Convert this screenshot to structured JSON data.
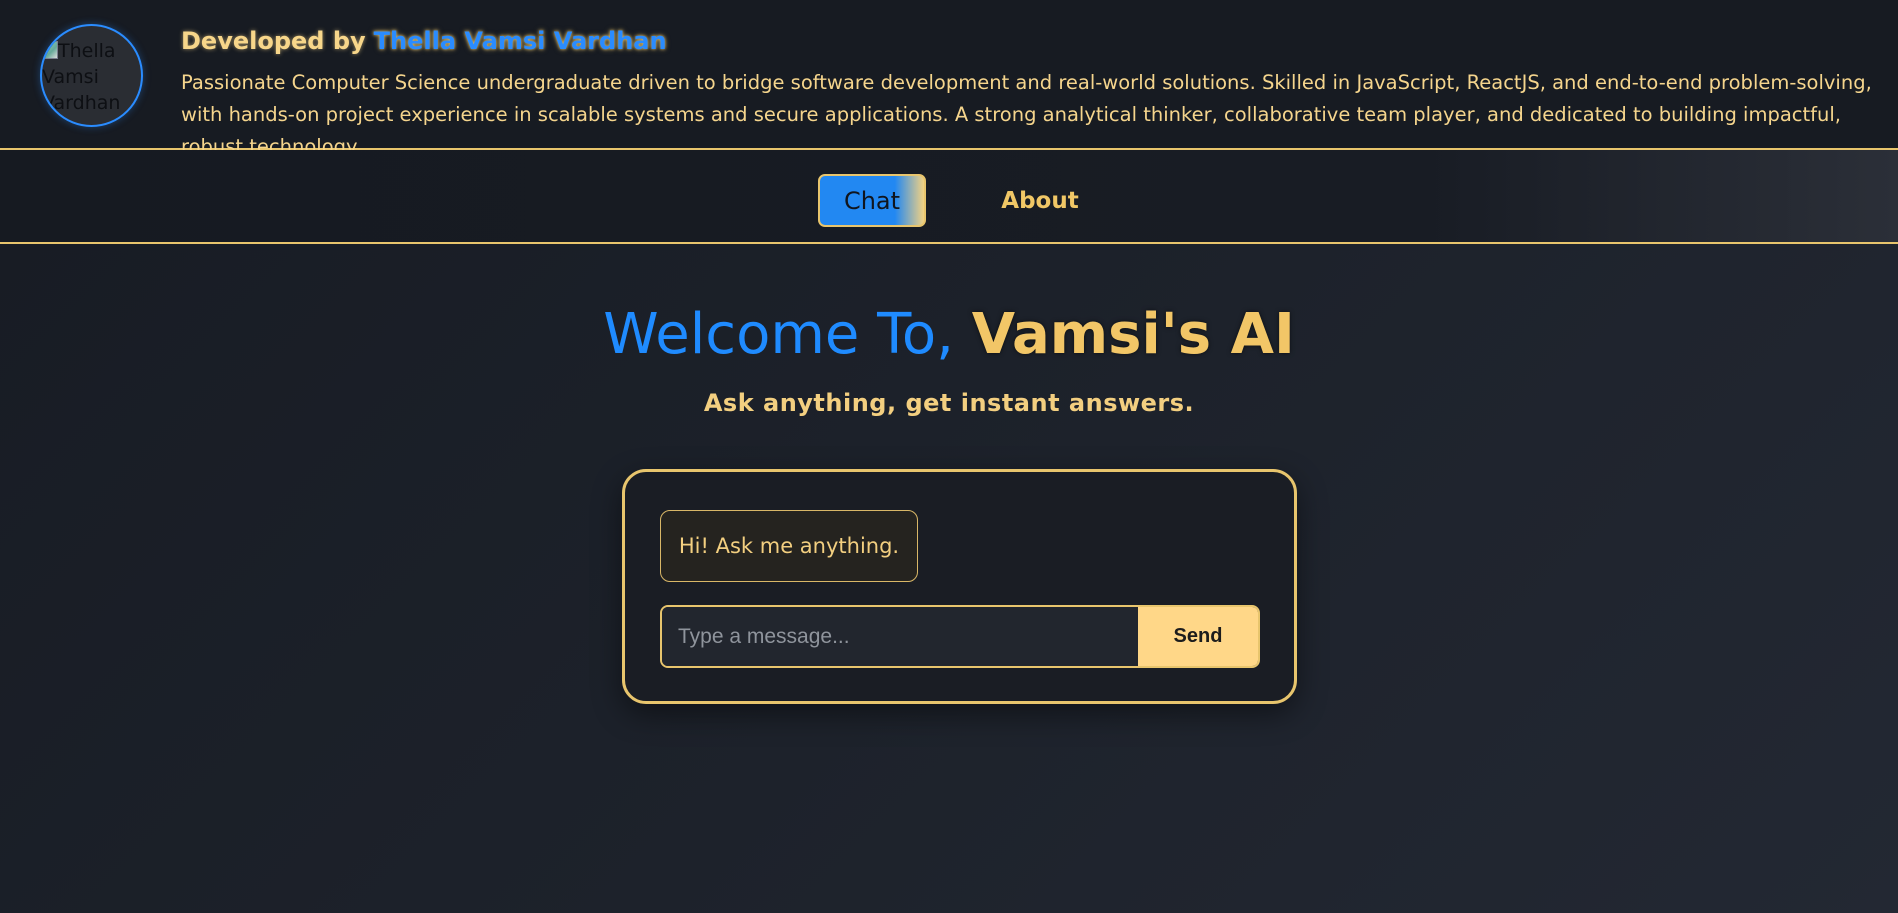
{
  "header": {
    "avatar_alt": "Thella Vamsi Vardhan",
    "developed_by_label": "Developed by",
    "developer_name": "Thella Vamsi Vardhan",
    "bio": "Passionate Computer Science undergraduate driven to bridge software development and real-world solutions. Skilled in JavaScript, ReactJS, and end-to-end problem-solving, with hands-on project experience in scalable systems and secure applications. A strong analytical thinker, collaborative team player, and dedicated to building impactful, robust technology."
  },
  "nav": {
    "tabs": [
      {
        "label": "Chat",
        "active": true
      },
      {
        "label": "About",
        "active": false
      }
    ]
  },
  "main": {
    "welcome_prefix": "Welcome To,",
    "welcome_brand": "Vamsi's AI",
    "subtitle": "Ask anything, get instant answers."
  },
  "chat": {
    "messages": [
      {
        "sender": "bot",
        "text": "Hi! Ask me anything."
      }
    ],
    "input_placeholder": "Type a message...",
    "input_value": "",
    "send_label": "Send"
  },
  "colors": {
    "accent_blue": "#1f8bff",
    "accent_gold": "#e8c56d",
    "background": "#1a1e26"
  }
}
